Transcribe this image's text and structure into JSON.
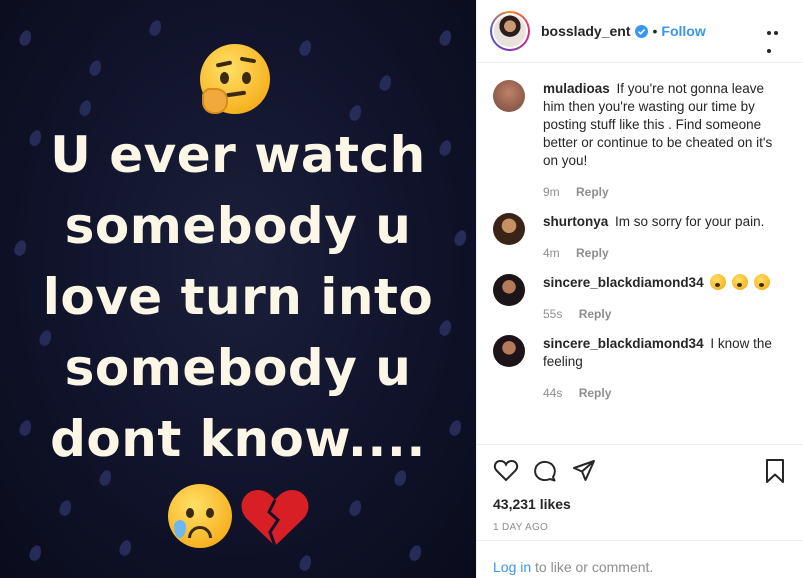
{
  "post": {
    "image_lines": [
      "U ever watch",
      "somebody u",
      "love turn into",
      "somebody u",
      "dont know...."
    ]
  },
  "header": {
    "username": "bosslady_ent",
    "separator": "•",
    "follow_label": "Follow"
  },
  "comments": [
    {
      "user": "muladioas",
      "text": "If you're not gonna leave him then you're wasting our time by posting stuff like this . Find someone better or continue to be cheated on it's on you!",
      "time": "9m",
      "reply": "Reply",
      "avatar_color": "#8a5a4a"
    },
    {
      "user": "shurtonya",
      "text": "Im so sorry for your pain.",
      "time": "4m",
      "reply": "Reply",
      "avatar_color": "#7a5230"
    },
    {
      "user": "sincere_blackdiamond34",
      "text": "",
      "time": "55s",
      "reply": "Reply",
      "avatar_color": "#2a2030"
    },
    {
      "user": "sincere_blackdiamond34",
      "text": "I know the feeling",
      "time": "44s",
      "reply": "Reply",
      "avatar_color": "#2a2030"
    }
  ],
  "actions": {
    "likes": "43,231 likes",
    "posted": "1 DAY AGO"
  },
  "login": {
    "link": "Log in",
    "rest": " to like or comment."
  },
  "colors": {
    "accent": "#3897f0",
    "text": "#262626",
    "muted": "#8e8e8e"
  }
}
